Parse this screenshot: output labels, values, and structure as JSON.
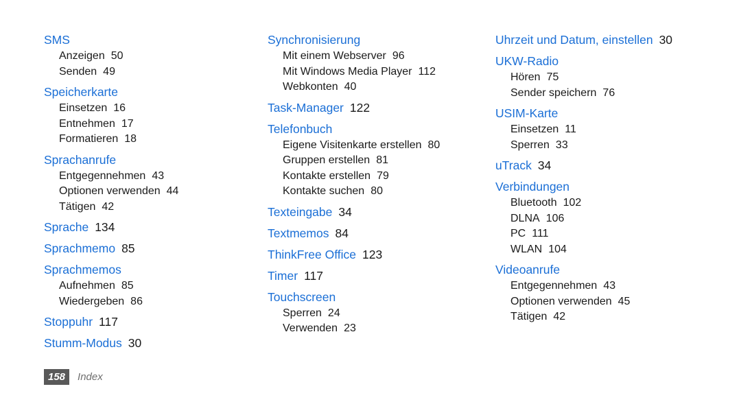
{
  "document": {
    "section_title": "Index",
    "page_number": "158",
    "accent_color": "#1b6fd6",
    "text_color": "#1a1a1a",
    "folio_box_color": "#595959",
    "background_color": "#ffffff"
  },
  "columns": [
    {
      "entries": [
        {
          "term": "SMS",
          "page": "",
          "subitems": [
            {
              "term": "Anzeigen",
              "page": "50"
            },
            {
              "term": "Senden",
              "page": "49"
            }
          ]
        },
        {
          "term": "Speicherkarte",
          "page": "",
          "subitems": [
            {
              "term": "Einsetzen",
              "page": "16"
            },
            {
              "term": "Entnehmen",
              "page": "17"
            },
            {
              "term": "Formatieren",
              "page": "18"
            }
          ]
        },
        {
          "term": "Sprachanrufe",
          "page": "",
          "subitems": [
            {
              "term": "Entgegennehmen",
              "page": "43"
            },
            {
              "term": "Optionen verwenden",
              "page": "44"
            },
            {
              "term": "Tätigen",
              "page": "42"
            }
          ]
        },
        {
          "term": "Sprache",
          "page": "134",
          "subitems": []
        },
        {
          "term": "Sprachmemo",
          "page": "85",
          "subitems": []
        },
        {
          "term": "Sprachmemos",
          "page": "",
          "subitems": [
            {
              "term": "Aufnehmen",
              "page": "85"
            },
            {
              "term": "Wiedergeben",
              "page": "86"
            }
          ]
        },
        {
          "term": "Stoppuhr",
          "page": "117",
          "subitems": []
        },
        {
          "term": "Stumm-Modus",
          "page": "30",
          "subitems": []
        }
      ]
    },
    {
      "entries": [
        {
          "term": "Synchronisierung",
          "page": "",
          "subitems": [
            {
              "term": "Mit einem Webserver",
              "page": "96"
            },
            {
              "term": "Mit Windows Media Player",
              "page": "112"
            },
            {
              "term": "Webkonten",
              "page": "40"
            }
          ]
        },
        {
          "term": "Task-Manager",
          "page": "122",
          "subitems": []
        },
        {
          "term": "Telefonbuch",
          "page": "",
          "subitems": [
            {
              "term": "Eigene Visitenkarte erstellen",
              "page": "80"
            },
            {
              "term": "Gruppen erstellen",
              "page": "81"
            },
            {
              "term": "Kontakte erstellen",
              "page": "79"
            },
            {
              "term": "Kontakte suchen",
              "page": "80"
            }
          ]
        },
        {
          "term": "Texteingabe",
          "page": "34",
          "subitems": []
        },
        {
          "term": "Textmemos",
          "page": "84",
          "subitems": []
        },
        {
          "term": "ThinkFree Office",
          "page": "123",
          "subitems": []
        },
        {
          "term": "Timer",
          "page": "117",
          "subitems": []
        },
        {
          "term": "Touchscreen",
          "page": "",
          "subitems": [
            {
              "term": "Sperren",
              "page": "24"
            },
            {
              "term": "Verwenden",
              "page": "23"
            }
          ]
        }
      ]
    },
    {
      "entries": [
        {
          "term": "Uhrzeit und Datum, einstellen",
          "page": "30",
          "subitems": []
        },
        {
          "term": "UKW-Radio",
          "page": "",
          "subitems": [
            {
              "term": "Hören",
              "page": "75"
            },
            {
              "term": "Sender speichern",
              "page": "76"
            }
          ]
        },
        {
          "term": "USIM-Karte",
          "page": "",
          "subitems": [
            {
              "term": "Einsetzen",
              "page": "11"
            },
            {
              "term": "Sperren",
              "page": "33"
            }
          ]
        },
        {
          "term": "uTrack",
          "page": "34",
          "subitems": []
        },
        {
          "term": "Verbindungen",
          "page": "",
          "subitems": [
            {
              "term": "Bluetooth",
              "page": "102"
            },
            {
              "term": "DLNA",
              "page": "106"
            },
            {
              "term": "PC",
              "page": "111"
            },
            {
              "term": "WLAN",
              "page": "104"
            }
          ]
        },
        {
          "term": "Videoanrufe",
          "page": "",
          "subitems": [
            {
              "term": "Entgegennehmen",
              "page": "43"
            },
            {
              "term": "Optionen verwenden",
              "page": "45"
            },
            {
              "term": "Tätigen",
              "page": "42"
            }
          ]
        }
      ]
    }
  ]
}
